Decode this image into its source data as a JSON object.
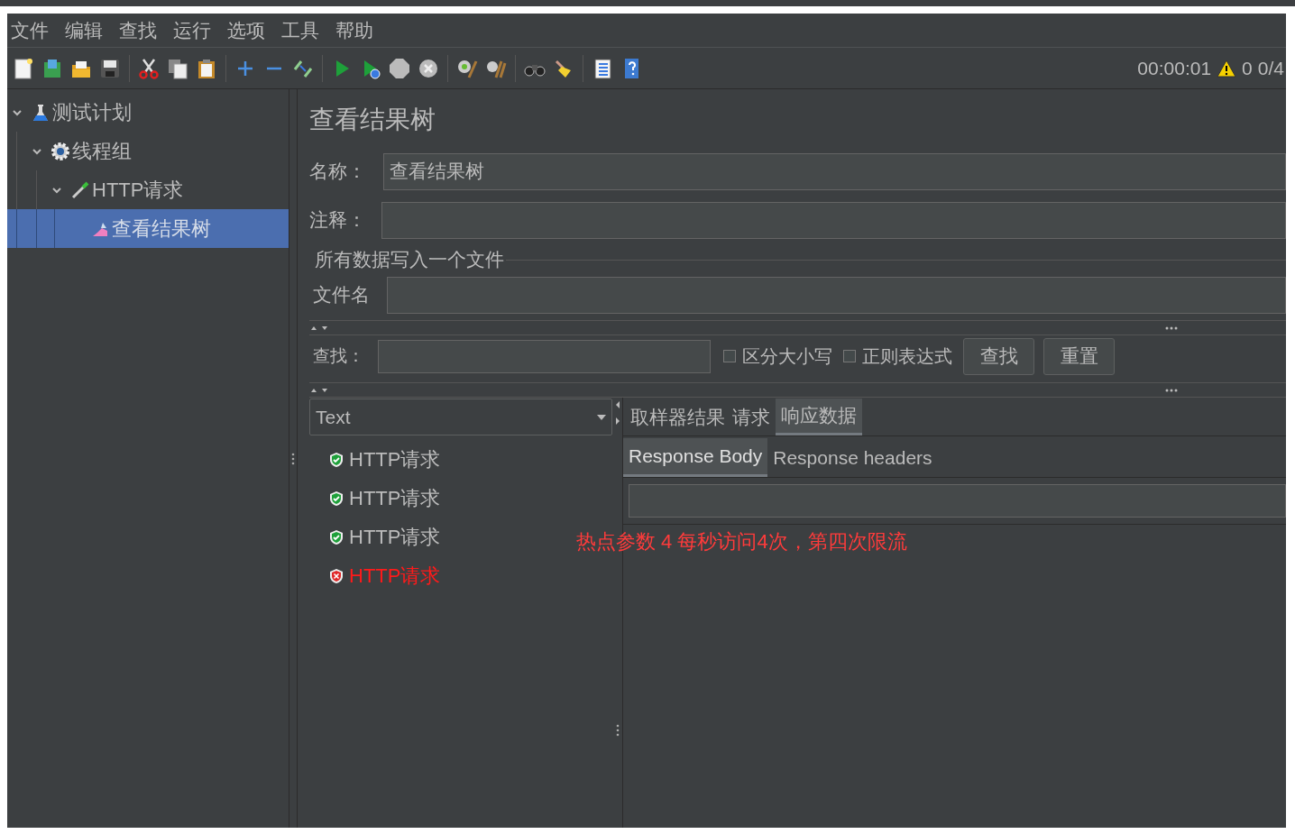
{
  "menu": [
    "文件",
    "编辑",
    "查找",
    "运行",
    "选项",
    "工具",
    "帮助"
  ],
  "status": {
    "elapsed": "00:00:01",
    "warnings": "0",
    "threads": "0/4"
  },
  "tree": [
    {
      "label": "测试计划",
      "kind": "plan",
      "expanded": true,
      "selected": false,
      "children": [
        {
          "label": "线程组",
          "kind": "thread-group",
          "expanded": true,
          "selected": false,
          "children": [
            {
              "label": "HTTP请求",
              "kind": "sampler",
              "expanded": true,
              "selected": false,
              "children": [
                {
                  "label": "查看结果树",
                  "kind": "listener",
                  "selected": true
                }
              ]
            }
          ]
        }
      ]
    }
  ],
  "panel": {
    "title": "查看结果树",
    "name_label": "名称：",
    "name_value": "查看结果树",
    "comment_label": "注释：",
    "file_group": "所有数据写入一个文件",
    "file_label": "文件名"
  },
  "search": {
    "label": "查找：",
    "options": [
      {
        "label": "区分大小写",
        "checked": false
      },
      {
        "label": "正则表达式",
        "checked": false
      }
    ],
    "buttons": [
      "查找",
      "重置"
    ]
  },
  "renderer": "Text",
  "results": [
    {
      "label": "HTTP请求",
      "failed": false
    },
    {
      "label": "HTTP请求",
      "failed": false
    },
    {
      "label": "HTTP请求",
      "failed": false
    },
    {
      "label": "HTTP请求",
      "failed": true
    }
  ],
  "tabs": [
    {
      "label": "取样器结果",
      "selected": false
    },
    {
      "label": "请求",
      "selected": false
    },
    {
      "label": "响应数据",
      "selected": true
    }
  ],
  "subtabs": [
    {
      "label": "Response Body",
      "selected": true
    },
    {
      "label": "Response headers",
      "selected": false
    }
  ],
  "annotation": "热点参数 4 每秒访问4次，第四次限流"
}
